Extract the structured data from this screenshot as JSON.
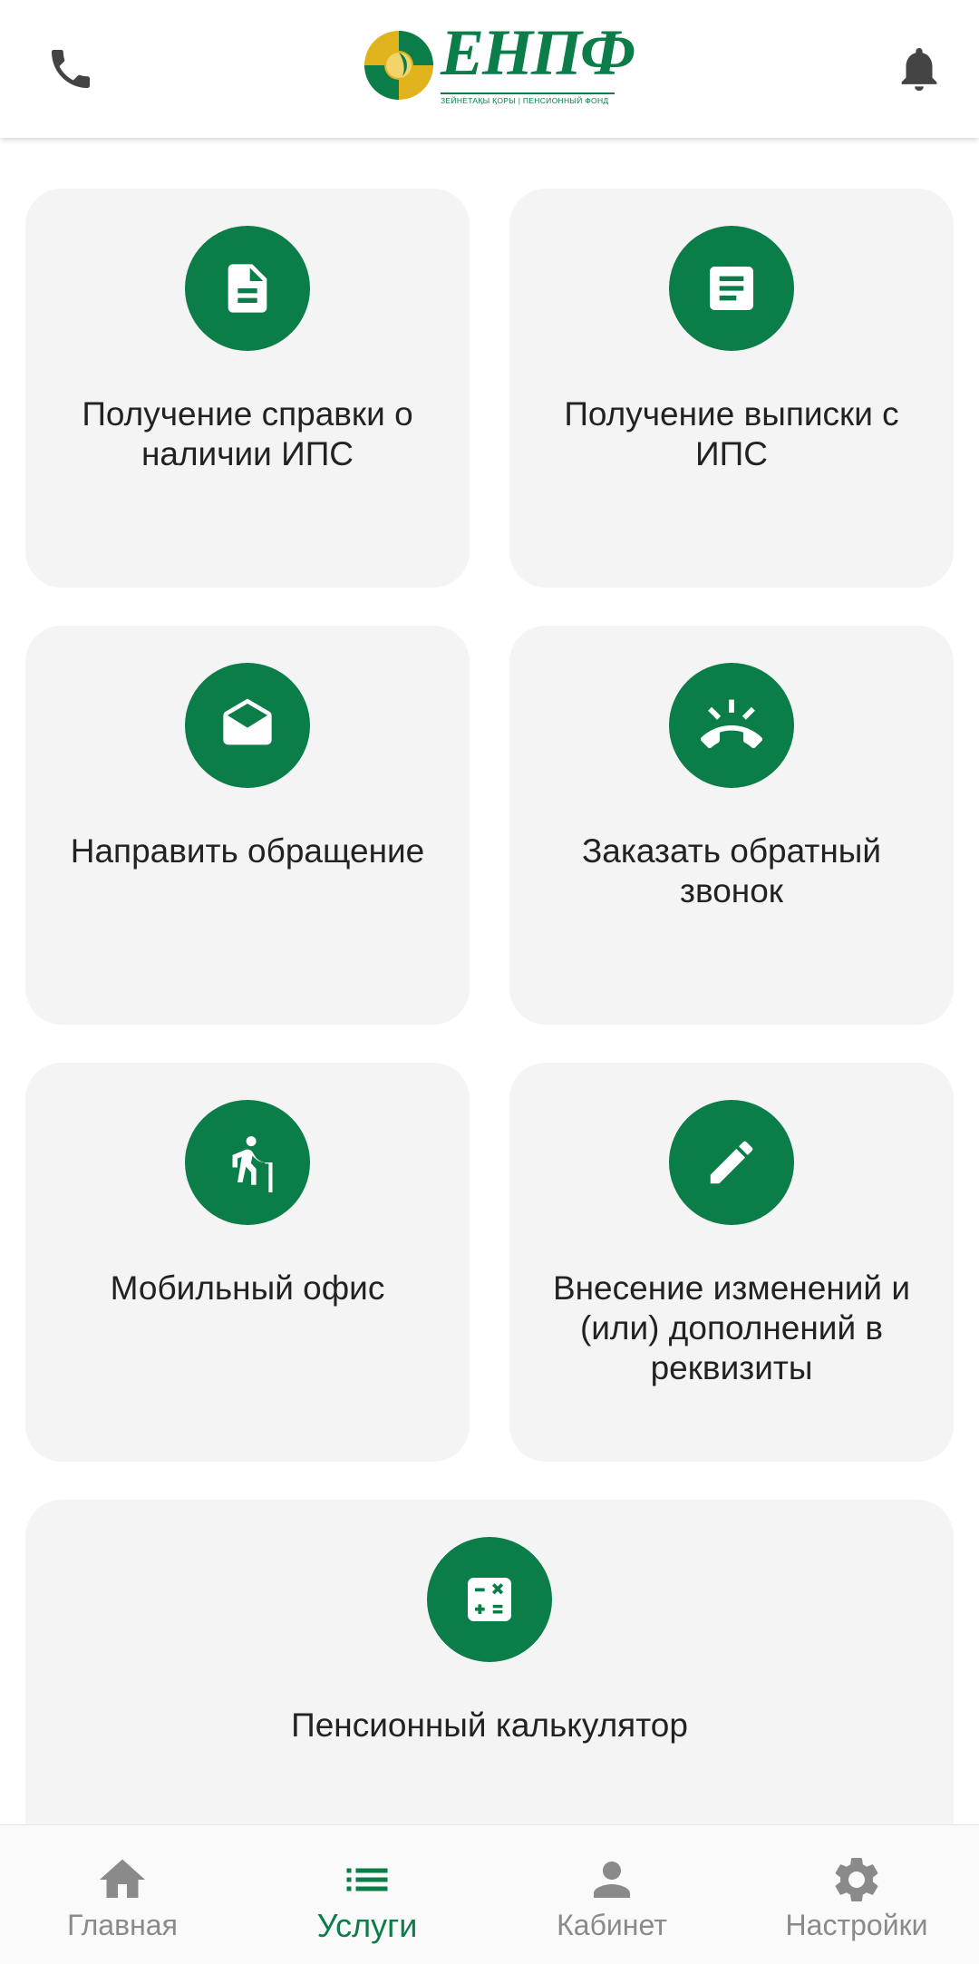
{
  "header": {
    "logo_text": "ЕНПФ",
    "logo_subtitle": "ЗЕЙНЕТАҚЫ ҚОРЫ | ПЕНСИОННЫЙ ФОНД",
    "left_icon": "phone-icon",
    "right_icon": "bell-icon"
  },
  "services": [
    {
      "label": "Получение справки о наличии ИПС",
      "icon": "document-icon"
    },
    {
      "label": "Получение выписки с ИПС",
      "icon": "document-lines-icon"
    },
    {
      "label": "Направить обращение",
      "icon": "open-envelope-icon"
    },
    {
      "label": "Заказать обратный звонок",
      "icon": "ringing-phone-icon"
    },
    {
      "label": "Мобильный офис",
      "icon": "elderly-person-icon"
    },
    {
      "label": "Внесение изменений и (или) дополнений в реквизиты",
      "icon": "pencil-icon"
    },
    {
      "label": "Пенсионный калькулятор",
      "icon": "calculator-icon"
    }
  ],
  "bottom_nav": [
    {
      "label": "Главная",
      "icon": "home-icon",
      "active": false
    },
    {
      "label": "Услуги",
      "icon": "list-icon",
      "active": true
    },
    {
      "label": "Кабинет",
      "icon": "person-icon",
      "active": false
    },
    {
      "label": "Настройки",
      "icon": "gear-icon",
      "active": false
    }
  ],
  "colors": {
    "accent": "#0b7d48",
    "card_background": "#f4f4f4",
    "nav_inactive": "#8a8a8a",
    "logo_gold": "#e0b21c"
  }
}
